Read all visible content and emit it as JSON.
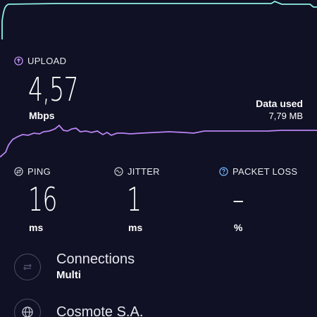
{
  "colors": {
    "background": "#101124",
    "download_line": "#8ff0e4",
    "upload_line": "#b985f4",
    "upload_accent": "#c897ff",
    "ping_accent": "#d9d9e3",
    "packet_loss_accent": "#78b8ff"
  },
  "upload": {
    "label": "UPLOAD",
    "icon": "arrow-up-circle-icon",
    "value": "4,57",
    "unit": "Mbps"
  },
  "data_used": {
    "title": "Data used",
    "value": "7,79 MB"
  },
  "ping": {
    "label": "PING",
    "icon": "ping-arrows-icon",
    "value": "16",
    "unit": "ms"
  },
  "jitter": {
    "label": "JITTER",
    "icon": "jitter-wave-icon",
    "value": "1",
    "unit": "ms"
  },
  "packet_loss": {
    "label": "PACKET LOSS",
    "icon": "question-circle-icon",
    "value": "–",
    "unit": "%"
  },
  "connections": {
    "title": "Connections",
    "value": "Multi",
    "icon": "connections-arrows-icon"
  },
  "provider": {
    "title": "Cosmote S.A.",
    "icon": "globe-icon"
  }
}
